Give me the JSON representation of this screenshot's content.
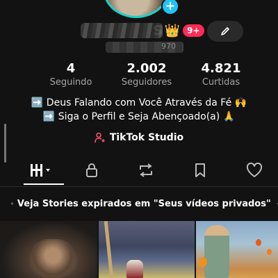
{
  "profile": {
    "name_visible_tail": "S",
    "crown_emoji": "👑",
    "notification_badge": "9+",
    "username_tail": "970"
  },
  "stats": [
    {
      "value": "4",
      "label": "Seguindo"
    },
    {
      "value": "2.002",
      "label": "Seguidores"
    },
    {
      "value": "4.821",
      "label": "Curtidas"
    }
  ],
  "bio": {
    "line1": "➡️ Deus Falando com Você Através da Fé 🙌",
    "line2": "➡️ Siga o Perfil e Seja Abençoado(a) 🙏"
  },
  "studio": {
    "label": "TikTok Studio"
  },
  "tabs": [
    {
      "icon": "videos-grid-icon"
    },
    {
      "icon": "lock-icon"
    },
    {
      "icon": "repost-icon"
    },
    {
      "icon": "bookmark-icon"
    },
    {
      "icon": "heart-icon"
    }
  ],
  "banner": {
    "text": "Veja Stories expirados em \"Seus vídeos privados\""
  },
  "colors": {
    "background": "#121212",
    "accent_badge": "#ff2b56",
    "avatar_ring": "#1ad0c8",
    "plus_button": "#20c4f4",
    "studio_icon": "#ff4d6d"
  }
}
